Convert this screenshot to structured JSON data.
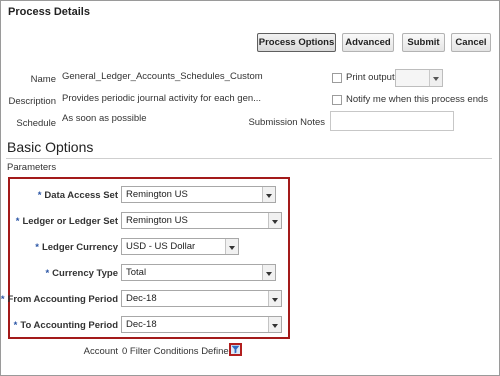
{
  "header": {
    "title": "Process Details"
  },
  "toolbar": {
    "process_options": "Process Options",
    "advanced": "Advanced",
    "submit": "Submit",
    "cancel": "Cancel"
  },
  "details": {
    "name_label": "Name",
    "name_value": "General_Ledger_Accounts_Schedules_Custom",
    "description_label": "Description",
    "description_value": "Provides periodic journal activity for each gen...",
    "schedule_label": "Schedule",
    "schedule_value": "As soon as possible",
    "print_output_label": "Print output",
    "notify_label": "Notify me when this process ends",
    "submission_notes_label": "Submission Notes",
    "submission_notes_value": ""
  },
  "basic": {
    "heading": "Basic Options",
    "subheading": "Parameters",
    "params": [
      {
        "label": "Data Access Set",
        "value": "Remington US"
      },
      {
        "label": "Ledger or Ledger Set",
        "value": "Remington US"
      },
      {
        "label": "Ledger Currency",
        "value": "USD - US Dollar"
      },
      {
        "label": "Currency Type",
        "value": "Total"
      },
      {
        "label": "From Accounting Period",
        "value": "Dec-18"
      },
      {
        "label": "To Accounting Period",
        "value": "Dec-18"
      }
    ],
    "account_label": "Account",
    "account_value": "0 Filter Conditions Defined"
  },
  "colors": {
    "highlight": "#a31a1a",
    "required": "#2a55a5"
  },
  "icons": [
    "dropdown-arrow-icon",
    "filter-icon"
  ]
}
